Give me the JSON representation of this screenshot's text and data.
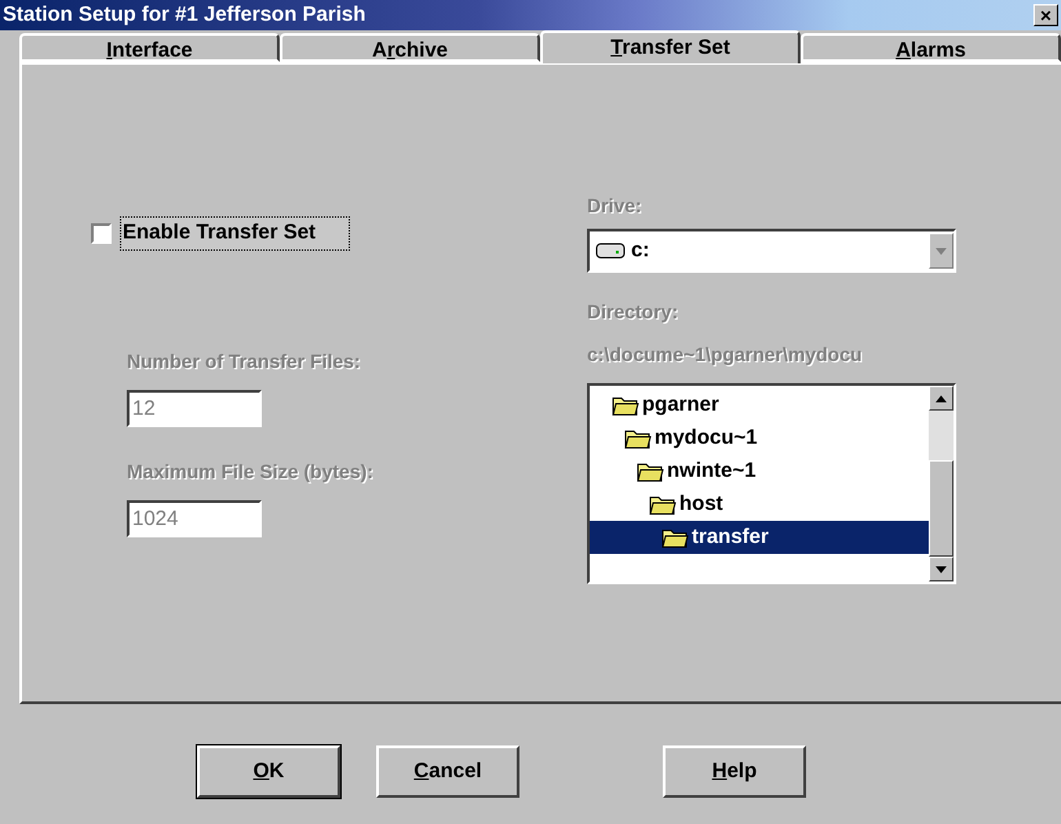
{
  "window": {
    "title": "Station Setup for #1 Jefferson Parish",
    "close": "×"
  },
  "tabs": [
    {
      "mnemonic": "I",
      "label_rest": "nterface",
      "selected": false
    },
    {
      "label_start": "A",
      "mnemonic": "r",
      "label_rest": "chive",
      "selected": false
    },
    {
      "mnemonic": "T",
      "label_rest": "ransfer Set",
      "selected": true
    },
    {
      "mnemonic": "A",
      "label_rest": "larms",
      "selected": false
    }
  ],
  "enable": {
    "label": "Enable Transfer Set",
    "checked": false
  },
  "fields": [
    {
      "label": "Number of Transfer Files:",
      "value": "12",
      "disabled": true
    },
    {
      "label": "Maximum File Size (bytes):",
      "value": "1024",
      "disabled": true
    }
  ],
  "drive": {
    "label": "Drive:",
    "value": "c:",
    "disabled": true
  },
  "directory": {
    "label": "Directory:",
    "path": "c:\\docume~1\\pgarner\\mydocu",
    "disabled": true,
    "tree": [
      {
        "name": "pgarner",
        "selected": false,
        "children": [
          {
            "name": "mydocu~1",
            "selected": false,
            "children": [
              {
                "name": "nwinte~1",
                "selected": false,
                "children": [
                  {
                    "name": "host",
                    "selected": false,
                    "children": [
                      {
                        "name": "transfer",
                        "selected": true
                      }
                    ]
                  }
                ]
              }
            ]
          }
        ]
      }
    ]
  },
  "buttons": [
    {
      "mnemonic": "O",
      "label_rest": "K",
      "default": true
    },
    {
      "mnemonic": "C",
      "label_rest": "ancel",
      "default": false
    },
    {
      "mnemonic": "H",
      "label_rest": "elp",
      "default": false
    }
  ]
}
